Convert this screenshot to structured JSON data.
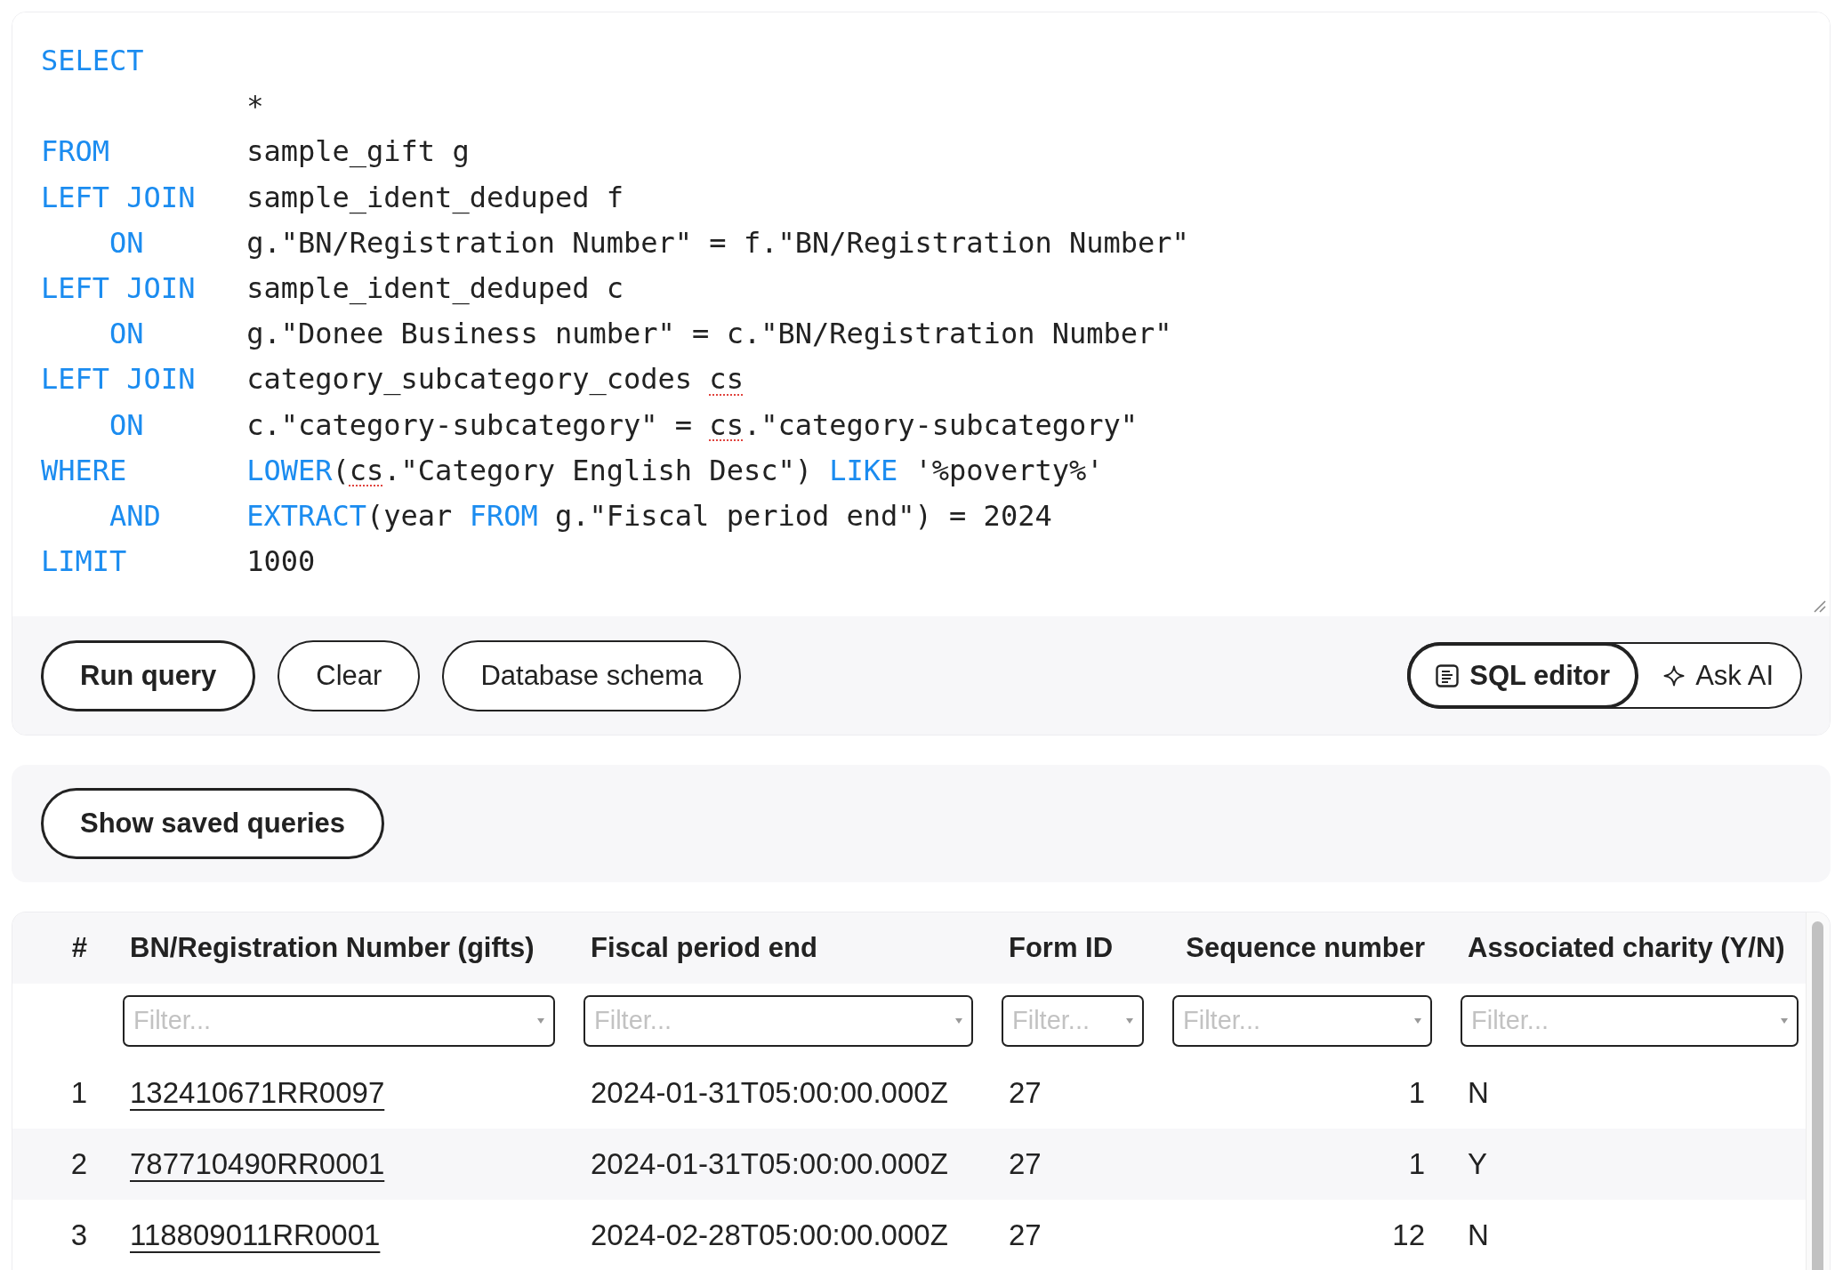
{
  "editor": {
    "lines": [
      {
        "clause": "SELECT"
      },
      {
        "tokens": [
          {
            "text": "*",
            "kind": "plain",
            "flagged": false
          }
        ]
      },
      {
        "clause": "FROM",
        "tokens": [
          {
            "text": "sample_gift g",
            "kind": "plain",
            "flagged": false
          }
        ]
      },
      {
        "clause": "LEFT JOIN",
        "tokens": [
          {
            "text": "sample_ident_deduped f",
            "kind": "plain",
            "flagged": false
          }
        ],
        "children": [
          {
            "clause": "ON",
            "tokens": [
              {
                "text": "g.\"BN/Registration Number\" = f.\"BN/Registration Number\"",
                "kind": "plain",
                "flagged": false
              }
            ]
          }
        ]
      },
      {
        "clause": "LEFT JOIN",
        "tokens": [
          {
            "text": "sample_ident_deduped c",
            "kind": "plain",
            "flagged": false
          }
        ],
        "children": [
          {
            "clause": "ON",
            "tokens": [
              {
                "text": "g.\"Donee Business number\" = c.\"BN/Registration Number\"",
                "kind": "plain",
                "flagged": false
              }
            ]
          }
        ]
      },
      {
        "clause": "LEFT JOIN",
        "tokens": [
          {
            "text": "category_subcategory_codes ",
            "kind": "plain",
            "flagged": false
          },
          {
            "text": "cs",
            "kind": "plain",
            "flagged": true
          }
        ],
        "children": [
          {
            "clause": "ON",
            "tokens": [
              {
                "text": "c.\"category-subcategory\" = ",
                "kind": "plain",
                "flagged": false
              },
              {
                "text": "cs",
                "kind": "plain",
                "flagged": true
              },
              {
                "text": ".\"category-subcategory\"",
                "kind": "plain",
                "flagged": false
              }
            ]
          }
        ]
      },
      {
        "clause": "WHERE",
        "tokens": [
          {
            "text": "LOWER",
            "kind": "keyword",
            "flagged": false
          },
          {
            "text": "(",
            "kind": "plain",
            "flagged": false
          },
          {
            "text": "cs",
            "kind": "plain",
            "flagged": true
          },
          {
            "text": ".\"Category English Desc\") ",
            "kind": "plain",
            "flagged": false
          },
          {
            "text": "LIKE",
            "kind": "keyword",
            "flagged": false
          },
          {
            "text": " '%poverty%'",
            "kind": "plain",
            "flagged": false
          }
        ],
        "children": [
          {
            "clause": "AND",
            "tokens": [
              {
                "text": "EXTRACT",
                "kind": "keyword",
                "flagged": false
              },
              {
                "text": "(year ",
                "kind": "plain",
                "flagged": false
              },
              {
                "text": "FROM",
                "kind": "keyword",
                "flagged": false
              },
              {
                "text": " g.\"Fiscal period end\") = 2024",
                "kind": "plain",
                "flagged": false
              }
            ]
          }
        ]
      },
      {
        "clause": "LIMIT",
        "tokens": [
          {
            "text": "1000",
            "kind": "plain",
            "flagged": false
          }
        ]
      }
    ]
  },
  "toolbar": {
    "buttons": [
      {
        "label": "Run query",
        "primary": true
      },
      {
        "label": "Clear",
        "primary": false
      },
      {
        "label": "Database schema",
        "primary": false
      }
    ],
    "modes": [
      {
        "label": "SQL editor",
        "kind": "editor",
        "selected": true
      },
      {
        "label": "Ask AI",
        "kind": "ai",
        "selected": false
      }
    ]
  },
  "saved_queries": {
    "button": "Show saved queries"
  },
  "table": {
    "columns": [
      {
        "label": "#",
        "kind": "index"
      },
      {
        "label": "BN/Registration Number (gifts)",
        "kind": "link",
        "placeholder": "Filter..."
      },
      {
        "label": "Fiscal period end",
        "kind": "text",
        "placeholder": "Filter..."
      },
      {
        "label": "Form ID",
        "kind": "text",
        "placeholder": "Filter..."
      },
      {
        "label": "Sequence number",
        "kind": "number",
        "placeholder": "Filter..."
      },
      {
        "label": "Associated charity (Y/N)",
        "kind": "text",
        "placeholder": "Filter..."
      }
    ],
    "rows": [
      [
        "1",
        "132410671RR0097",
        "2024-01-31T05:00:00.000Z",
        "27",
        "1",
        "N"
      ],
      [
        "2",
        "787710490RR0001",
        "2024-01-31T05:00:00.000Z",
        "27",
        "1",
        "Y"
      ],
      [
        "3",
        "118809011RR0001",
        "2024-02-28T05:00:00.000Z",
        "27",
        "12",
        "N"
      ]
    ]
  }
}
